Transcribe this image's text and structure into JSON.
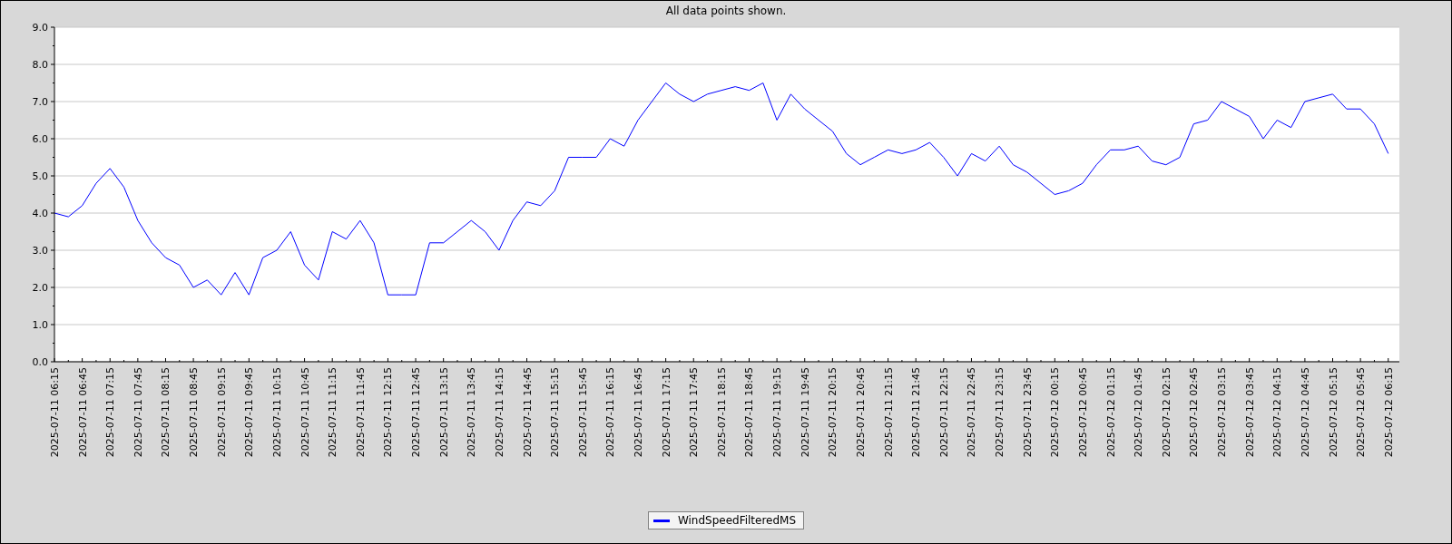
{
  "chart_data": {
    "type": "line",
    "title": "All data points shown.",
    "categories": [
      "2025-07-11 06:15",
      null,
      "2025-07-11 06:45",
      null,
      "2025-07-11 07:15",
      null,
      "2025-07-11 07:45",
      null,
      "2025-07-11 08:15",
      null,
      "2025-07-11 08:45",
      null,
      "2025-07-11 09:15",
      null,
      "2025-07-11 09:45",
      null,
      "2025-07-11 10:15",
      null,
      "2025-07-11 10:45",
      null,
      "2025-07-11 11:15",
      null,
      "2025-07-11 11:45",
      null,
      "2025-07-11 12:15",
      null,
      "2025-07-11 12:45",
      null,
      "2025-07-11 13:15",
      null,
      "2025-07-11 13:45",
      null,
      "2025-07-11 14:15",
      null,
      "2025-07-11 14:45",
      null,
      "2025-07-11 15:15",
      null,
      "2025-07-11 15:45",
      null,
      "2025-07-11 16:15",
      null,
      "2025-07-11 16:45",
      null,
      "2025-07-11 17:15",
      null,
      "2025-07-11 17:45",
      null,
      "2025-07-11 18:15",
      null,
      "2025-07-11 18:45",
      null,
      "2025-07-11 19:15",
      null,
      "2025-07-11 19:45",
      null,
      "2025-07-11 20:15",
      null,
      "2025-07-11 20:45",
      null,
      "2025-07-11 21:15",
      null,
      "2025-07-11 21:45",
      null,
      "2025-07-11 22:15",
      null,
      "2025-07-11 22:45",
      null,
      "2025-07-11 23:15",
      null,
      "2025-07-11 23:45",
      null,
      "2025-07-12 00:15",
      null,
      "2025-07-12 00:45",
      null,
      "2025-07-12 01:15",
      null,
      "2025-07-12 01:45",
      null,
      "2025-07-12 02:15",
      null,
      "2025-07-12 02:45",
      null,
      "2025-07-12 03:15",
      null,
      "2025-07-12 03:45",
      null,
      "2025-07-12 04:15",
      null,
      "2025-07-12 04:45",
      null,
      "2025-07-12 05:15",
      null,
      "2025-07-12 05:45",
      null,
      "2025-07-12 06:15"
    ],
    "series": [
      {
        "name": "WindSpeedFilteredMS",
        "color": "#0000ff",
        "values": [
          4.0,
          3.9,
          4.2,
          4.8,
          5.2,
          4.7,
          3.8,
          3.2,
          2.8,
          2.6,
          2.0,
          2.2,
          1.8,
          2.4,
          1.8,
          2.8,
          3.0,
          3.5,
          2.6,
          2.2,
          3.5,
          3.3,
          3.8,
          3.2,
          1.8,
          1.8,
          1.8,
          3.2,
          3.2,
          3.5,
          3.8,
          3.5,
          3.0,
          3.8,
          4.3,
          4.2,
          4.6,
          5.5,
          5.5,
          5.5,
          6.0,
          5.8,
          6.5,
          7.0,
          7.5,
          7.2,
          7.0,
          7.2,
          7.3,
          7.4,
          7.3,
          7.5,
          6.5,
          7.2,
          6.8,
          6.5,
          6.2,
          5.6,
          5.3,
          5.5,
          5.7,
          5.6,
          5.7,
          5.9,
          5.5,
          5.0,
          5.6,
          5.4,
          5.8,
          5.3,
          5.1,
          4.8,
          4.5,
          4.6,
          4.8,
          5.3,
          5.7,
          5.7,
          5.8,
          5.4,
          5.3,
          5.5,
          6.4,
          6.5,
          7.0,
          6.8,
          6.6,
          6.0,
          6.5,
          6.3,
          7.0,
          7.1,
          7.2,
          6.8,
          6.8,
          6.4,
          5.6
        ]
      }
    ],
    "ylim": [
      0,
      9
    ],
    "grid": true,
    "yticks": [
      {
        "value": 0,
        "label": "0.0"
      },
      {
        "value": 1,
        "label": "1.0"
      },
      {
        "value": 2,
        "label": "2.0"
      },
      {
        "value": 3,
        "label": "3.0"
      },
      {
        "value": 4,
        "label": "4.0"
      },
      {
        "value": 5,
        "label": "5.0"
      },
      {
        "value": 6,
        "label": "6.0"
      },
      {
        "value": 7,
        "label": "7.0"
      },
      {
        "value": 8,
        "label": "8.0"
      },
      {
        "value": 9,
        "label": "9.0"
      }
    ]
  }
}
